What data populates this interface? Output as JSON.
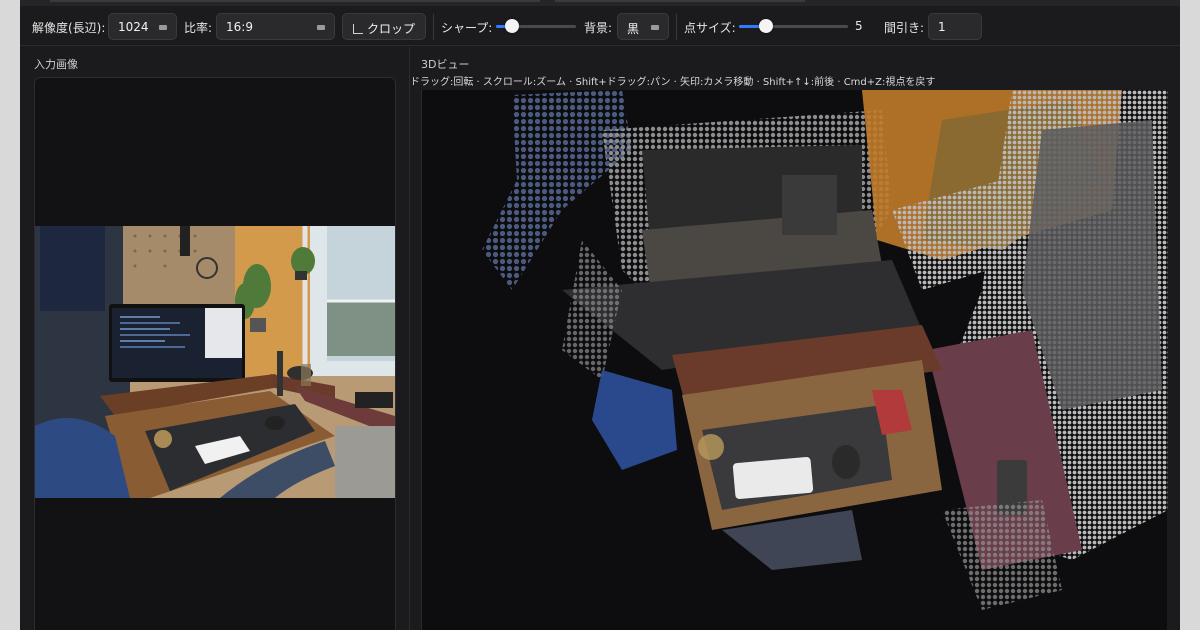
{
  "toolbar": {
    "resolution_label": "解像度(長辺):",
    "resolution_value": "1024",
    "ratio_label": "比率:",
    "ratio_value": "16:9",
    "crop_label": "クロップ",
    "sharpness_label": "シャープ:",
    "sharpness_level": 0.2,
    "background_label": "背景:",
    "background_value": "黒",
    "point_size_label": "点サイズ:",
    "point_size_value": "5",
    "point_size_level": 0.25,
    "decimation_label": "間引き:",
    "decimation_value": "1"
  },
  "left_panel": {
    "title": "入力画像"
  },
  "right_panel": {
    "title": "3Dビュー",
    "hint": "ドラッグ:回転 · スクロール:ズーム · Shift+ドラッグ:パン · 矢印:カメラ移動 · Shift+↑↓:前後 · Cmd+Z:視点を戻す"
  },
  "colors": {
    "accent": "#2f7bff",
    "background": "#1b1b1d",
    "panel": "#121214"
  }
}
